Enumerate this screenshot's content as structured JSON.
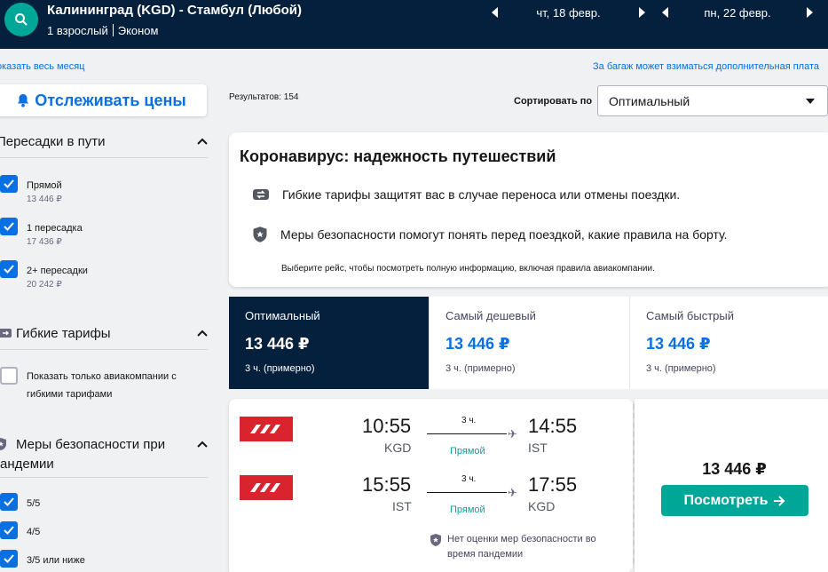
{
  "header": {
    "route": "Калининград (KGD) - Стамбул (Любой)",
    "passengers": "1 взрослый",
    "cabin": "Эконом",
    "depart_date": "чт, 18 февр.",
    "return_date": "пн, 22 февр."
  },
  "links": {
    "show_month": "оказать весь месяц",
    "baggage_note": "За багаж может взиматься дополнительная плата"
  },
  "sidebar": {
    "track_prices": "Отслеживать цены",
    "stops": {
      "title": "Пересадки в пути",
      "options": [
        {
          "label": "Прямой",
          "price": "13 446 ₽",
          "checked": true
        },
        {
          "label": "1 пересадка",
          "price": "17 436 ₽",
          "checked": true
        },
        {
          "label": "2+ пересадки",
          "price": "20 242 ₽",
          "checked": true
        }
      ]
    },
    "flexible": {
      "title": "Гибкие тарифы",
      "option_line1": "Показать только авиакомпании с",
      "option_line2": "гибкими тарифами",
      "checked": false
    },
    "safety": {
      "title_line1": "Меры безопасности при",
      "title_line2": "андемии",
      "options": [
        {
          "label": "5/5",
          "checked": true
        },
        {
          "label": "4/5",
          "checked": true
        },
        {
          "label": "3/5 или ниже",
          "checked": true
        }
      ]
    }
  },
  "results": {
    "count": "Результатов: 154",
    "sort_label": "Сортировать по",
    "sort_value": "Оптимальный"
  },
  "covid": {
    "title": "Коронавирус: надежность путешествий",
    "row1": "Гибкие тарифы защитят вас в случае переноса или отмены поездки.",
    "row2": "Меры безопасности помогут понять перед поездкой, какие правила на борту.",
    "note": "Выберите рейс, чтобы посмотреть полную информацию, включая правила авиакомпании."
  },
  "tabs": [
    {
      "name": "Оптимальный",
      "price": "13 446 ₽",
      "duration": "3 ч. (примерно)",
      "active": true
    },
    {
      "name": "Самый дешевый",
      "price": "13 446 ₽",
      "duration": "3 ч. (примерно)",
      "active": false
    },
    {
      "name": "Самый быстрый",
      "price": "13 446 ₽",
      "duration": "3 ч. (примерно)",
      "active": false
    }
  ],
  "flight": {
    "outbound": {
      "dep_time": "10:55",
      "dep_code": "KGD",
      "arr_time": "14:55",
      "arr_code": "IST",
      "duration": "3 ч.",
      "stops": "Прямой"
    },
    "inbound": {
      "dep_time": "15:55",
      "dep_code": "IST",
      "arr_time": "17:55",
      "arr_code": "KGD",
      "duration": "3 ч.",
      "stops": "Прямой"
    },
    "safety_note": "Нет оценки мер безопасности во время пандемии",
    "price": "13 446 ₽",
    "view_button": "Посмотреть"
  },
  "colors": {
    "header_bg": "#05203c",
    "accent_blue": "#0770e3",
    "accent_teal": "#00a698",
    "airline_red": "#d9232d"
  }
}
